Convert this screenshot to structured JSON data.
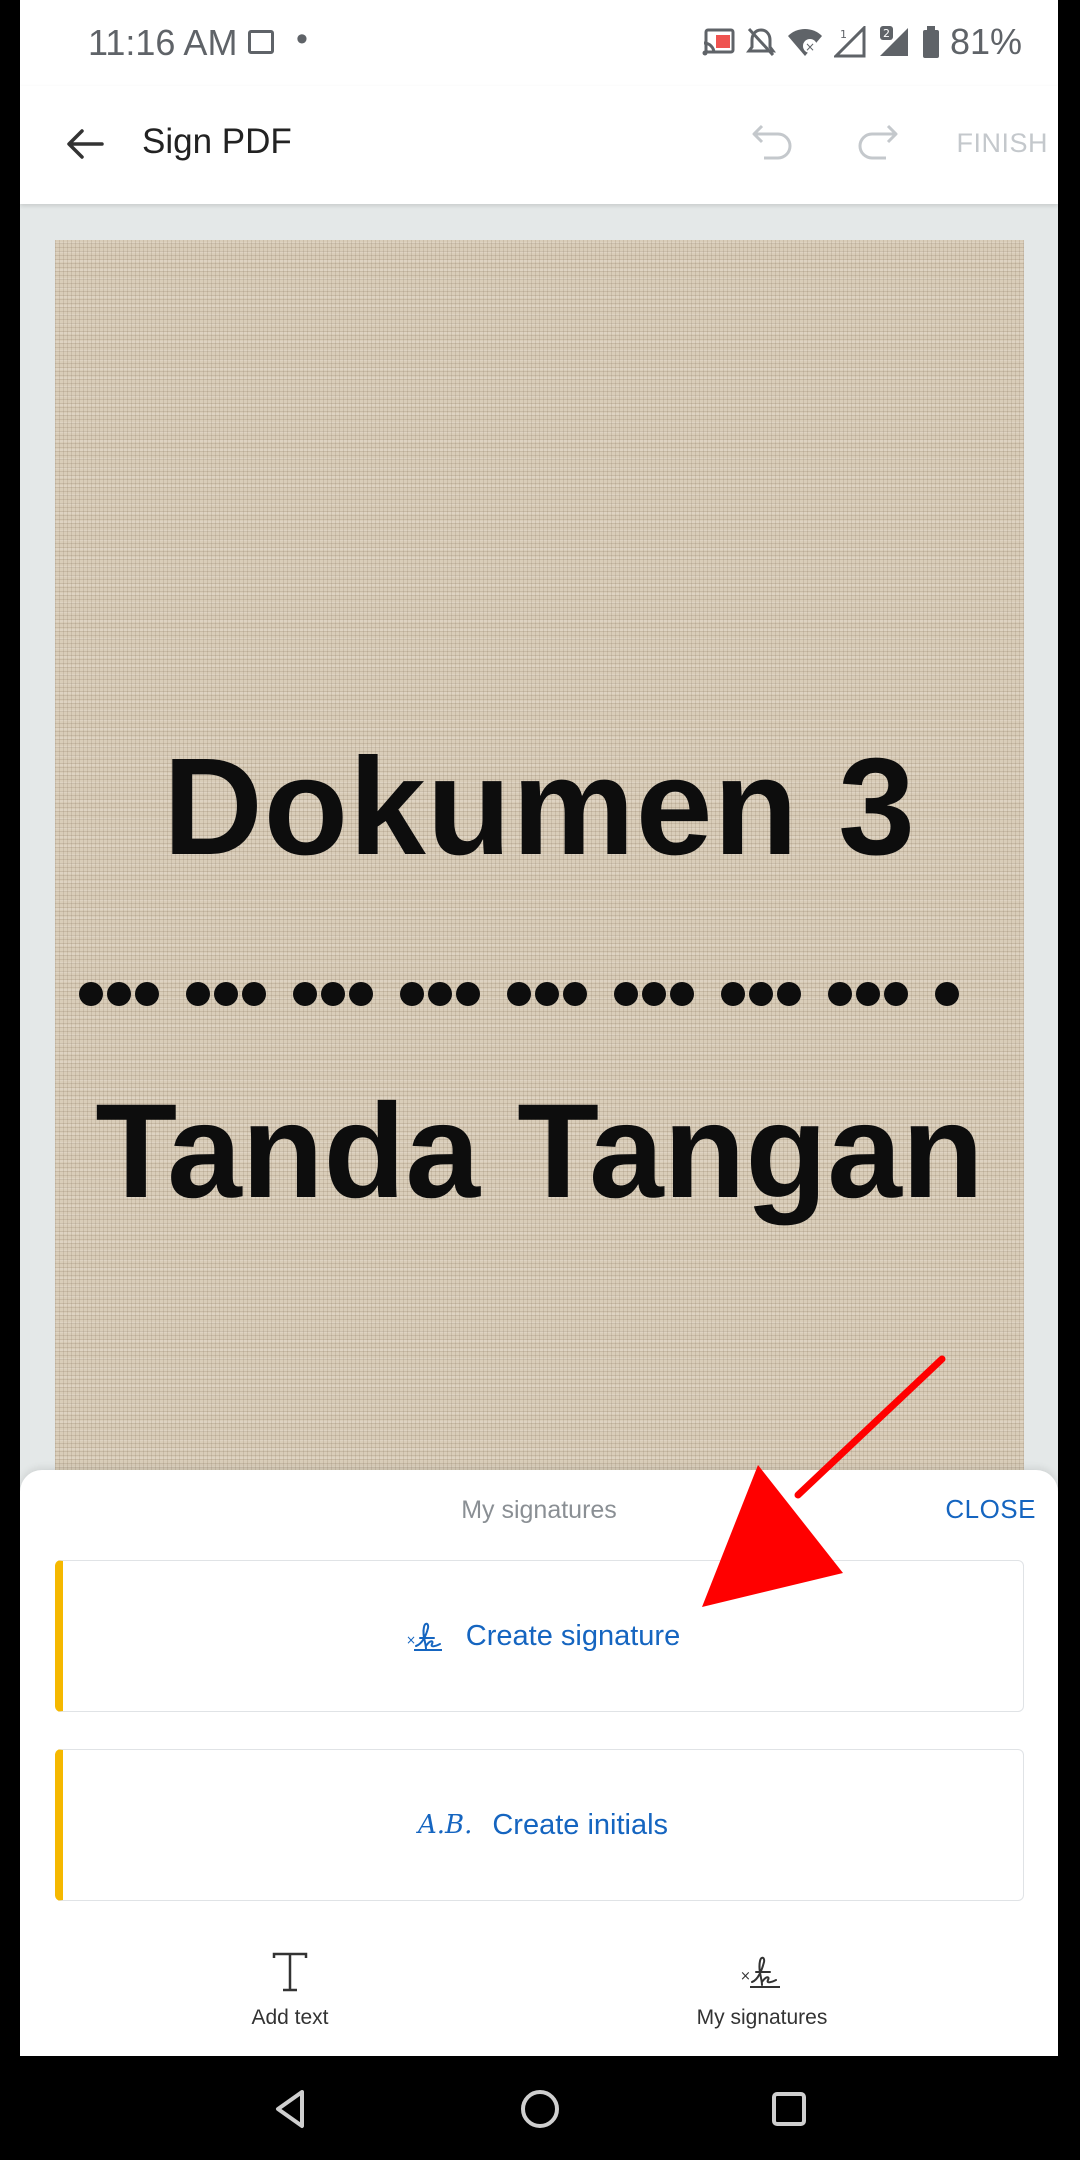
{
  "status_bar": {
    "time": "11:16 AM",
    "dot": "•",
    "battery_pct": "81%"
  },
  "app_bar": {
    "title": "Sign PDF",
    "finish_label": "FINISH"
  },
  "document": {
    "heading1": "Dokumen 3",
    "heading2": "Tanda Tangan"
  },
  "sheet": {
    "title": "My signatures",
    "close_label": "CLOSE",
    "create_signature_label": "Create signature",
    "create_initials_label": "Create initials",
    "initials_glyph": "A.B."
  },
  "tabs": {
    "add_text_label": "Add text",
    "my_signatures_label": "My signatures"
  },
  "colors": {
    "accent_blue": "#1565c0",
    "card_stripe": "#f5b800",
    "annotation_red": "#ff0000"
  }
}
